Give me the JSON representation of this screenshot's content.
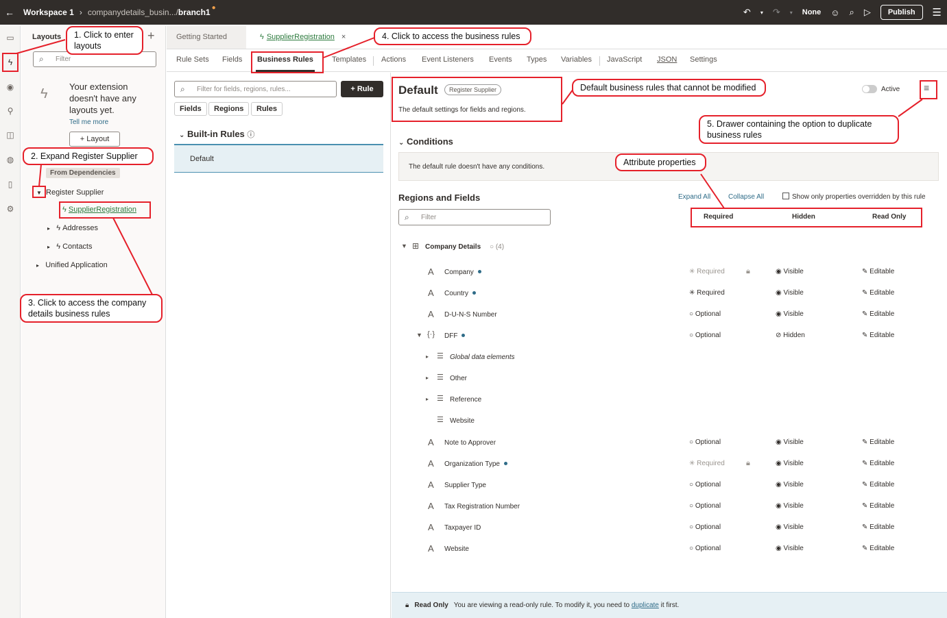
{
  "topbar": {
    "workspace": "Workspace 1",
    "path": "companydetails_busin.../",
    "branch": "branch1",
    "none_label": "None",
    "publish": "Publish"
  },
  "layouts": {
    "title": "Layouts",
    "filter_placeholder": "Filter",
    "empty_text": "Your extension doesn't have any layouts yet.",
    "tell_me_more": "Tell me more",
    "layout_button": "Layout",
    "dependencies_label": "From Dependencies",
    "tree": {
      "register_supplier": "Register Supplier",
      "supplier_registration": "SupplierRegistration",
      "addresses": "Addresses",
      "contacts": "Contacts",
      "unified_application": "Unified Application"
    }
  },
  "tabs": {
    "getting_started": "Getting Started",
    "supplier_registration": "SupplierRegistration"
  },
  "subtabs": [
    "Rule Sets",
    "Fields",
    "Business Rules",
    "Templates",
    "Actions",
    "Event Listeners",
    "Events",
    "Types",
    "Variables",
    "JavaScript",
    "JSON",
    "Settings"
  ],
  "rules_panel": {
    "filter_placeholder": "Filter for fields, regions, rules...",
    "rule_button": "Rule",
    "chips": [
      "Fields",
      "Regions",
      "Rules"
    ],
    "builtin_title": "Built-in Rules",
    "default_rule": "Default"
  },
  "detail": {
    "title": "Default",
    "badge": "Register Supplier",
    "subtitle": "The default settings for fields and regions.",
    "active_label": "Active",
    "conditions_title": "Conditions",
    "conditions_text": "The default rule doesn't have any conditions.",
    "regions_title": "Regions and Fields",
    "expand_all": "Expand All",
    "collapse_all": "Collapse All",
    "show_only": "Show only properties overridden by this rule",
    "filter_placeholder": "Filter",
    "col_required": "Required",
    "col_hidden": "Hidden",
    "col_readonly": "Read Only",
    "group": {
      "name": "Company Details",
      "count": "(4)"
    },
    "rows": [
      {
        "name": "Company",
        "req": "Required",
        "vis": "Visible",
        "edit": "Editable"
      },
      {
        "name": "Country",
        "req": "Required",
        "vis": "Visible",
        "edit": "Editable"
      },
      {
        "name": "D-U-N-S Number",
        "req": "Optional",
        "vis": "Visible",
        "edit": "Editable"
      },
      {
        "name": "DFF",
        "req": "Optional",
        "vis": "Hidden",
        "edit": "Editable"
      },
      {
        "name": "Global data elements"
      },
      {
        "name": "Other"
      },
      {
        "name": "Reference"
      },
      {
        "name": "Website"
      },
      {
        "name": "Note to Approver",
        "req": "Optional",
        "vis": "Visible",
        "edit": "Editable"
      },
      {
        "name": "Organization Type",
        "req": "Required",
        "vis": "Visible",
        "edit": "Editable"
      },
      {
        "name": "Supplier Type",
        "req": "Optional",
        "vis": "Visible",
        "edit": "Editable"
      },
      {
        "name": "Tax Registration Number",
        "req": "Optional",
        "vis": "Visible",
        "edit": "Editable"
      },
      {
        "name": "Taxpayer ID",
        "req": "Optional",
        "vis": "Visible",
        "edit": "Editable"
      },
      {
        "name": "Website",
        "req": "Optional",
        "vis": "Visible",
        "edit": "Editable"
      }
    ]
  },
  "footer": {
    "label": "Read Only",
    "text": "You are viewing a read-only rule. To modify it, you need to",
    "link": "duplicate",
    "tail": "it first."
  },
  "annotations": {
    "a1": "1. Click to enter layouts",
    "a2": "2. Expand Register Supplier",
    "a3": "3. Click to access the company details business rules",
    "a4": "4. Click to access the business rules",
    "a5": "5. Drawer containing the option to duplicate business rules",
    "a6": "Default business rules that cannot be modified",
    "a7": "Attribute properties"
  },
  "colors": {
    "annotation": "#e5202a",
    "topbar": "#312d2a",
    "link": "#2f6c88",
    "green": "#2c7a3d"
  }
}
